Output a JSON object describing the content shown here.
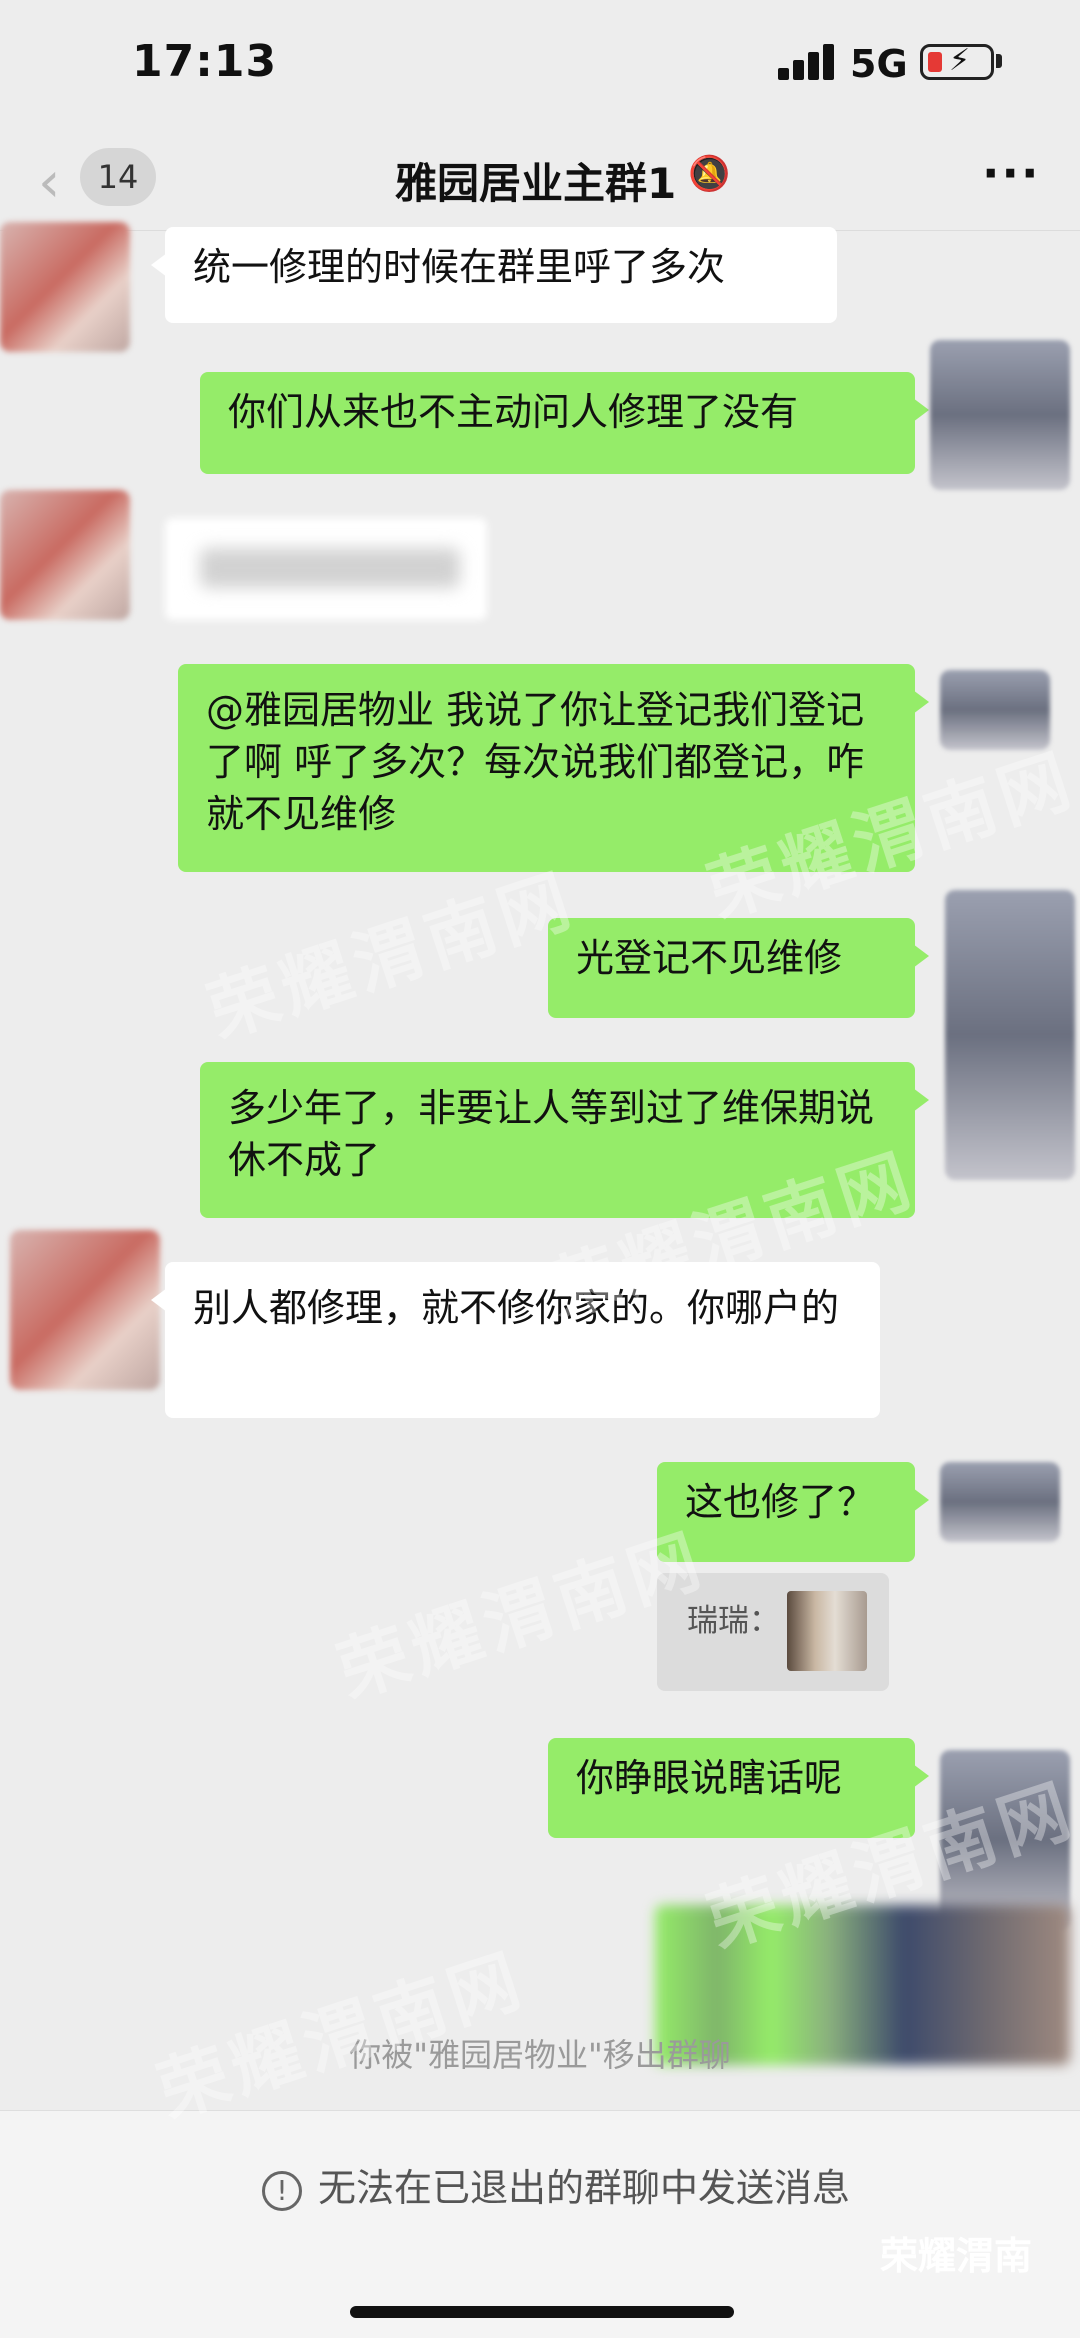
{
  "status_bar": {
    "time": "17:13",
    "network": "5G"
  },
  "nav": {
    "back_count": "14",
    "title": "雅园居业主群1"
  },
  "messages": [
    {
      "side": "in",
      "text": "统一修理的时候在群里呼了多次"
    },
    {
      "side": "out",
      "text": "你们从来也不主动问人修理了没有"
    },
    {
      "side": "out",
      "text": "@雅园居物业 我说了你让登记我们登记了啊  呼了多次？每次说我们都登记，咋就不见维修"
    },
    {
      "side": "out",
      "text": "光登记不见维修"
    },
    {
      "side": "out",
      "text": "多少年了，非要让人等到过了维保期说休不成了"
    },
    {
      "side": "in",
      "text": "别人都修理，就不修你家的。你哪户的"
    },
    {
      "side": "out",
      "text": "这也修了？"
    },
    {
      "side": "out",
      "text": "你睁眼说瞎话呢"
    }
  ],
  "quote": {
    "name": "瑞瑞："
  },
  "system_notice": "你被\"雅园居物业\"移出群聊",
  "bottom": {
    "notice": "无法在已退出的群聊中发送消息"
  },
  "watermark": {
    "text": "荣耀渭南网",
    "corner": "荣耀渭南"
  }
}
